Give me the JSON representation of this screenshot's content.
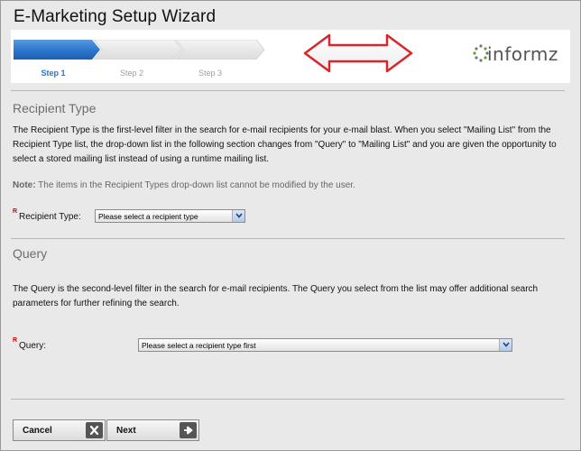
{
  "window": {
    "title": "E-Marketing Setup Wizard"
  },
  "steps": [
    {
      "label": "Step 1",
      "active": true
    },
    {
      "label": "Step 2",
      "active": false
    },
    {
      "label": "Step 3",
      "active": false
    }
  ],
  "logo": {
    "text": "informz"
  },
  "recipient_section": {
    "title": "Recipient Type",
    "description": "The Recipient Type is the first-level filter in the search for e-mail recipients for your e-mail blast. When you select \"Mailing List\" from the Recipient Type list, the drop-down list in the following section changes from \"Query\" to \"Mailing List\" and you are given the opportunity to select a stored mailing list instead of using a runtime mailing list.",
    "note_label": "Note:",
    "note_text": " The items in the Recipient Types drop-down list cannot be modified by the user.",
    "required_marker": "R",
    "field_label": "Recipient Type:",
    "select_value": "Please select a recipient type"
  },
  "query_section": {
    "title": "Query",
    "description": "The Query is the second-level filter in the search for e-mail recipients. The Query you select from the list may offer additional search parameters for further refining the search.",
    "required_marker": "R",
    "field_label": "Query:",
    "select_value": "Please select a recipient type first"
  },
  "buttons": {
    "cancel": "Cancel",
    "next": "Next"
  },
  "colors": {
    "step_active": "#2e74c8",
    "step_inactive": "#e3e3e3",
    "arrow_stroke": "#d9262b",
    "logo_accent": "#5aa52f"
  }
}
